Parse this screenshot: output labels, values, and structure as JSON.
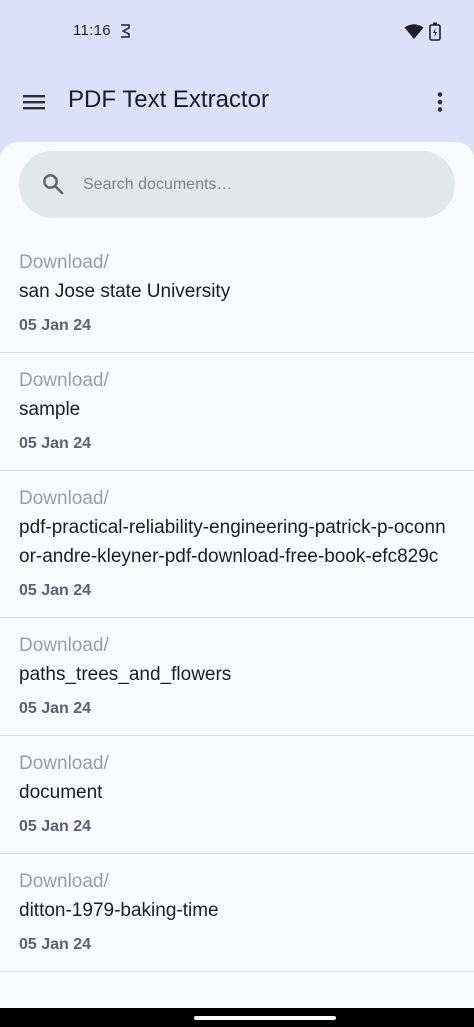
{
  "status": {
    "time": "11:16"
  },
  "app_bar": {
    "title": "PDF Text Extractor"
  },
  "search": {
    "placeholder": "Search documents…",
    "value": ""
  },
  "documents": [
    {
      "folder": "Download/",
      "name": "san Jose state University",
      "date": "05 Jan 24"
    },
    {
      "folder": "Download/",
      "name": "sample",
      "date": "05 Jan 24"
    },
    {
      "folder": "Download/",
      "name": "pdf-practical-reliability-engineering-patrick-p-oconnor-andre-kleyner-pdf-download-free-book-efc829c",
      "date": "05 Jan 24"
    },
    {
      "folder": "Download/",
      "name": "paths_trees_and_flowers",
      "date": "05 Jan 24"
    },
    {
      "folder": "Download/",
      "name": "document",
      "date": "05 Jan 24"
    },
    {
      "folder": "Download/",
      "name": "ditton-1979-baking-time",
      "date": "05 Jan 24"
    }
  ],
  "colors": {
    "app_bar_bg": "#dbe1fb",
    "sheet_bg": "#fafbff",
    "search_bg": "#e1e8e7",
    "date_text": "#5a6174"
  },
  "icons": [
    "menu-icon",
    "more-vert-icon",
    "search-icon",
    "wifi-icon",
    "battery-icon",
    "notification-icon"
  ]
}
